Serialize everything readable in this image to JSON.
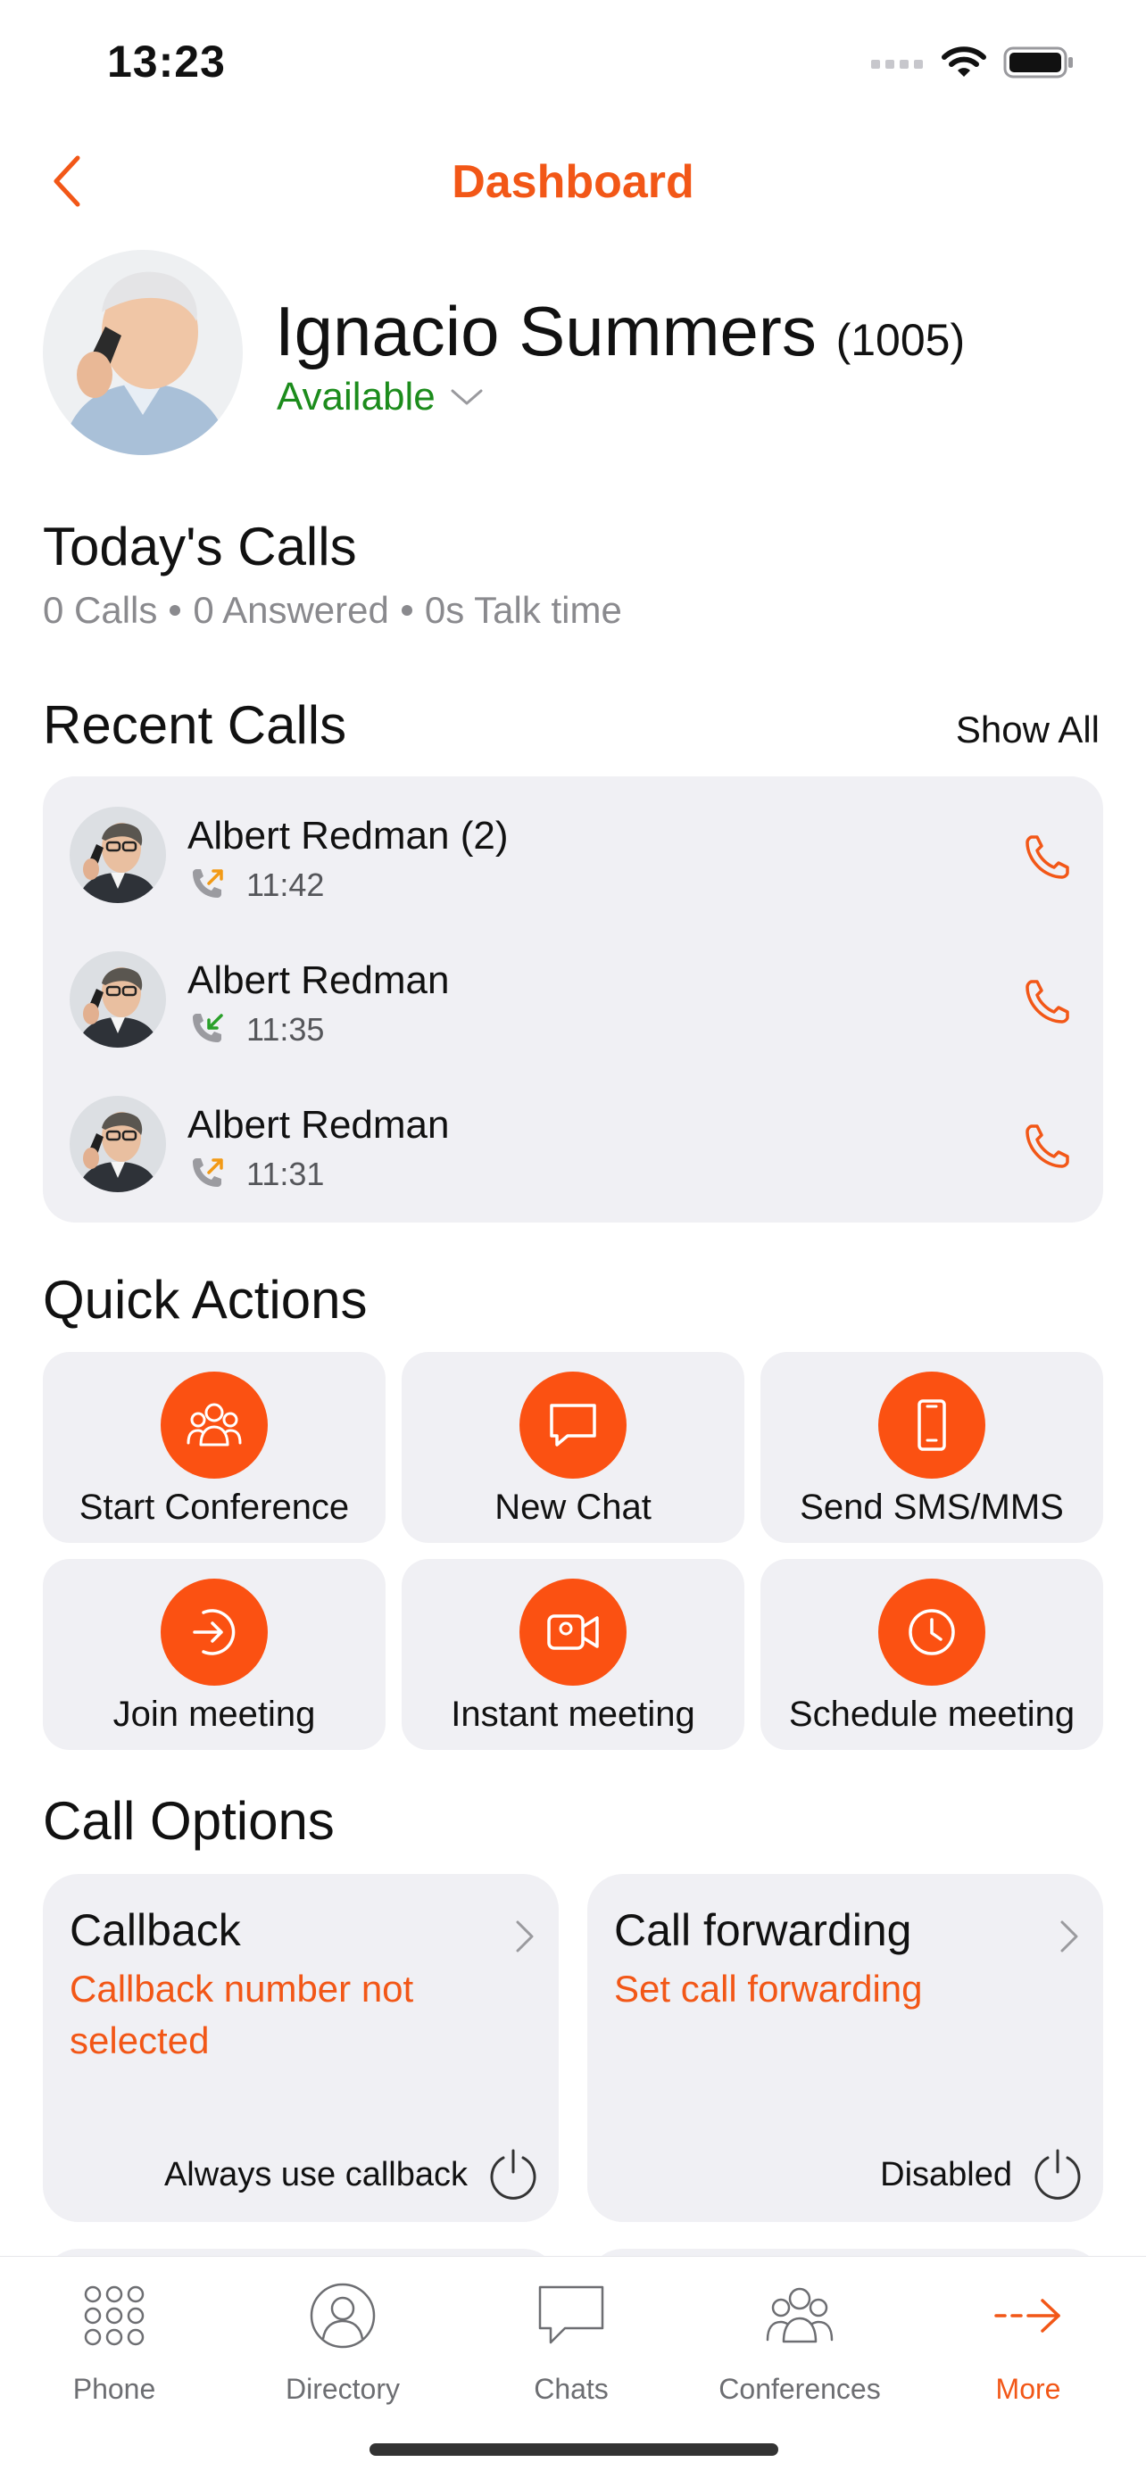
{
  "status_bar": {
    "time": "13:23"
  },
  "header": {
    "title": "Dashboard"
  },
  "profile": {
    "name": "Ignacio Summers",
    "extension": "(1005)",
    "presence": "Available"
  },
  "todays_calls": {
    "title": "Today's Calls",
    "calls": "0 Calls",
    "answered": "0 Answered",
    "talk_time": "0s Talk time"
  },
  "recent_calls": {
    "title": "Recent Calls",
    "show_all": "Show All",
    "items": [
      {
        "name": "Albert Redman (2)",
        "time": "11:42",
        "direction": "outgoing"
      },
      {
        "name": "Albert Redman",
        "time": "11:35",
        "direction": "incoming"
      },
      {
        "name": "Albert Redman",
        "time": "11:31",
        "direction": "outgoing"
      }
    ]
  },
  "quick_actions": {
    "title": "Quick Actions",
    "items": [
      {
        "label": "Start Conference",
        "icon": "conference-icon"
      },
      {
        "label": "New Chat",
        "icon": "chat-bubble-icon"
      },
      {
        "label": "Send SMS/MMS",
        "icon": "mobile-phone-icon"
      },
      {
        "label": "Join meeting",
        "icon": "join-arrow-icon"
      },
      {
        "label": "Instant meeting",
        "icon": "video-camera-icon"
      },
      {
        "label": "Schedule meeting",
        "icon": "clock-icon"
      }
    ]
  },
  "call_options": {
    "title": "Call Options",
    "callback": {
      "title": "Callback",
      "subtitle": "Callback number not selected",
      "footer": "Always use callback"
    },
    "forwarding": {
      "title": "Call forwarding",
      "subtitle": "Set call forwarding",
      "footer": "Disabled"
    }
  },
  "tabs": [
    {
      "label": "Phone",
      "icon": "keypad-icon",
      "active": false
    },
    {
      "label": "Directory",
      "icon": "person-icon",
      "active": false
    },
    {
      "label": "Chats",
      "icon": "chat-icon",
      "active": false
    },
    {
      "label": "Conferences",
      "icon": "conference-icon",
      "active": false
    },
    {
      "label": "More",
      "icon": "more-arrow-icon",
      "active": true
    }
  ],
  "colors": {
    "accent": "#f25717",
    "accent_fill": "#fb5112",
    "available": "#1c8c1c",
    "card_bg": "#f0f0f4",
    "muted_text": "#8a8a8e"
  }
}
